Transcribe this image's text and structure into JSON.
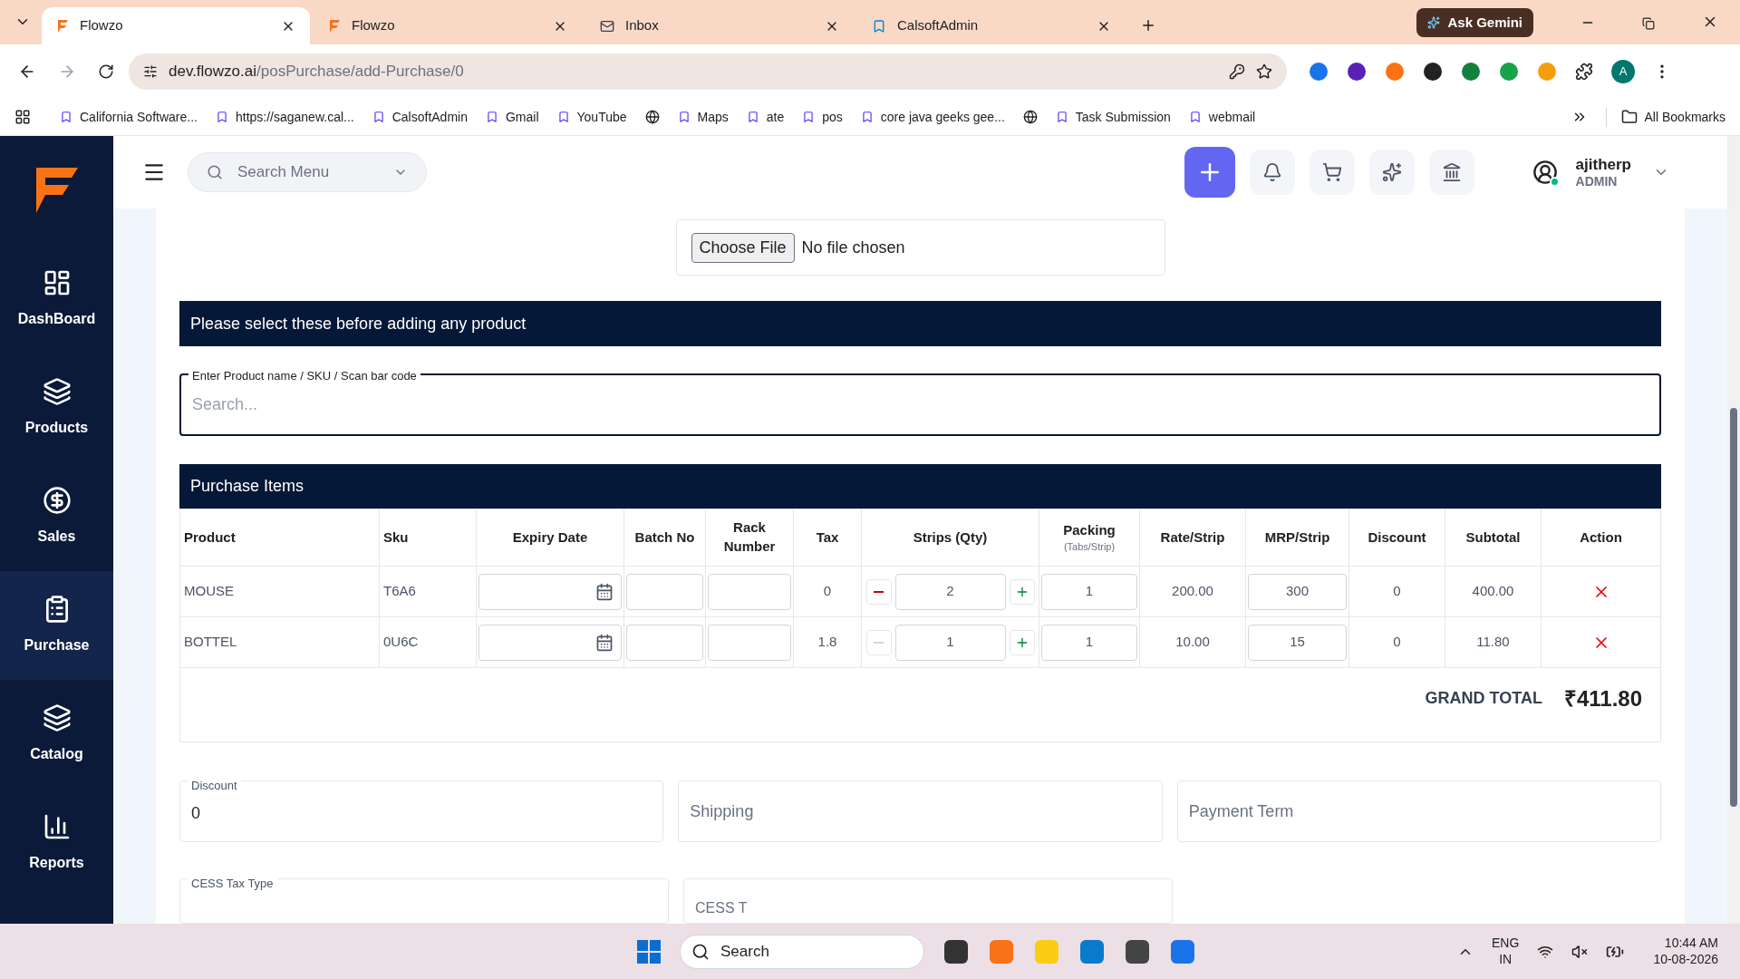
{
  "browser": {
    "tabs": [
      {
        "title": "Flowzo",
        "selected": true,
        "kind": "flowzo"
      },
      {
        "title": "Flowzo",
        "selected": false,
        "kind": "flowzo"
      },
      {
        "title": "Inbox",
        "selected": false,
        "kind": "mail"
      },
      {
        "title": "CalsoftAdmin",
        "selected": false,
        "kind": "admin"
      }
    ],
    "ask_gemini": "Ask Gemini",
    "url_host": "dev.flowzo.ai",
    "url_path": "/posPurchase/add-Purchase/0",
    "profile_initial": "A",
    "bookmarks": [
      {
        "kind": "link",
        "label": "California Software..."
      },
      {
        "kind": "link",
        "label": "https://saganew.cal..."
      },
      {
        "kind": "link",
        "label": "CalsoftAdmin"
      },
      {
        "kind": "link",
        "label": "Gmail"
      },
      {
        "kind": "link",
        "label": "YouTube"
      },
      {
        "kind": "icon"
      },
      {
        "kind": "link",
        "label": "Maps"
      },
      {
        "kind": "link",
        "label": "ate"
      },
      {
        "kind": "link",
        "label": "pos"
      },
      {
        "kind": "link",
        "label": "core java geeks gee..."
      },
      {
        "kind": "icon"
      },
      {
        "kind": "link",
        "label": "Task Submission"
      },
      {
        "kind": "link",
        "label": "webmail"
      }
    ],
    "all_bookmarks": "All Bookmarks"
  },
  "sidebar": {
    "items": [
      {
        "label": "DashBoard",
        "selected": false,
        "kind": "dashboard"
      },
      {
        "label": "Products",
        "selected": false,
        "kind": "products"
      },
      {
        "label": "Sales",
        "selected": false,
        "kind": "sales"
      },
      {
        "label": "Purchase",
        "selected": true,
        "kind": "purchase"
      },
      {
        "label": "Catalog",
        "selected": false,
        "kind": "catalog"
      },
      {
        "label": "Reports",
        "selected": false,
        "kind": "reports"
      }
    ]
  },
  "header": {
    "search_placeholder": "Search Menu",
    "user_name": "ajitherp",
    "user_role": "ADMIN"
  },
  "file_input": {
    "button": "Choose File",
    "status": "No file chosen"
  },
  "notice": "Please select these before adding any product",
  "product_search": {
    "label": "Enter Product name / SKU / Scan bar code",
    "placeholder": "Search..."
  },
  "purchase_items": {
    "title": "Purchase Items",
    "columns": [
      {
        "label": "Product"
      },
      {
        "label": "Sku"
      },
      {
        "label": "Expiry Date"
      },
      {
        "label": "Batch No"
      },
      {
        "label": "Rack Number"
      },
      {
        "label": "Tax"
      },
      {
        "label": "Strips (Qty)"
      },
      {
        "label": "Packing",
        "sub": "(Tabs/Strip)"
      },
      {
        "label": "Rate/Strip"
      },
      {
        "label": "MRP/Strip"
      },
      {
        "label": "Discount"
      },
      {
        "label": "Subtotal"
      },
      {
        "label": "Action"
      }
    ],
    "rows": [
      {
        "product": "MOUSE",
        "sku": "T6A6",
        "tax": "0",
        "qty": "2",
        "minus_disabled": false,
        "packing": "1",
        "rate": "200.00",
        "mrp": "300",
        "discount": "0",
        "subtotal": "400.00"
      },
      {
        "product": "BOTTEL",
        "sku": "0U6C",
        "tax": "1.8",
        "qty": "1",
        "minus_disabled": true,
        "packing": "1",
        "rate": "10.00",
        "mrp": "15",
        "discount": "0",
        "subtotal": "11.80"
      }
    ],
    "grand_total_label": "GRAND TOTAL",
    "grand_total": "₹411.80"
  },
  "fields": [
    {
      "label": "Discount",
      "value": "0"
    },
    {
      "placeholder": "Shipping"
    },
    {
      "placeholder": "Payment Term"
    }
  ],
  "cess": {
    "label": "CESS Tax Type",
    "placeholder": "CESS T"
  },
  "taskbar": {
    "search": "Search",
    "lang": "ENG",
    "region": "IN",
    "time": "10:44 AM",
    "date": "10-08-2026"
  }
}
